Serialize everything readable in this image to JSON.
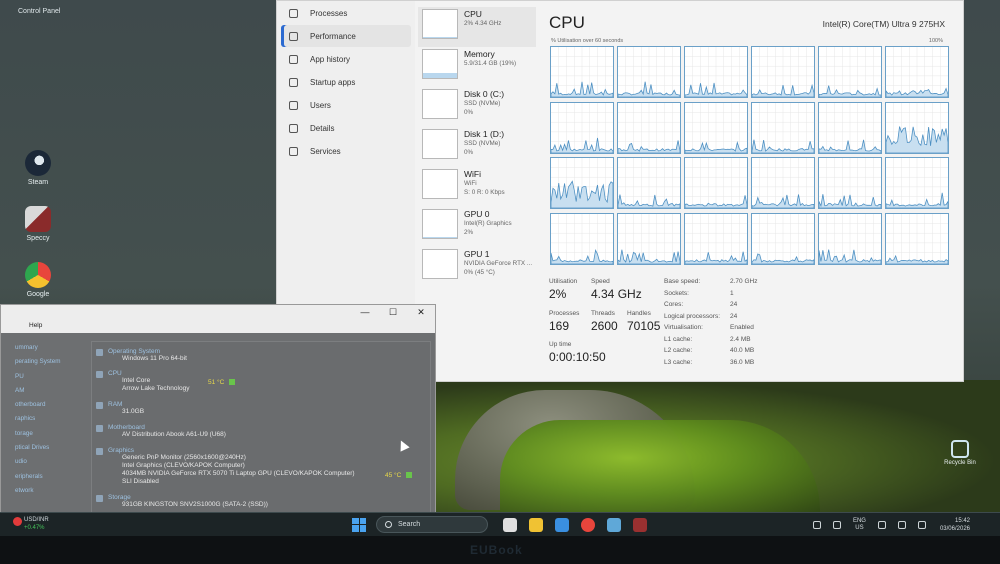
{
  "desktop": {
    "control_panel_label": "Control Panel",
    "icons": [
      {
        "name": "steam",
        "label": "Steam",
        "color": "#1b2838"
      },
      {
        "name": "speccy",
        "label": "Speccy",
        "color": "#8a2b2b"
      },
      {
        "name": "google",
        "label": "Google",
        "color": "#e8453c"
      }
    ],
    "recycle_bin_label": "Recycle Bin"
  },
  "task_manager": {
    "nav": [
      {
        "label": "Processes",
        "icon": "processes-icon"
      },
      {
        "label": "Performance",
        "icon": "performance-icon",
        "active": true
      },
      {
        "label": "App history",
        "icon": "app-history-icon"
      },
      {
        "label": "Startup apps",
        "icon": "startup-icon"
      },
      {
        "label": "Users",
        "icon": "users-icon"
      },
      {
        "label": "Details",
        "icon": "details-icon"
      },
      {
        "label": "Services",
        "icon": "services-icon"
      }
    ],
    "resources": [
      {
        "name": "CPU",
        "line1": "2% 4.34 GHz",
        "line2": "",
        "line3": "",
        "fill": 0.02
      },
      {
        "name": "Memory",
        "line1": "5.9/31.4 GB (19%)",
        "line2": "",
        "line3": "",
        "fill": 0.19
      },
      {
        "name": "Disk 0 (C:)",
        "line1": "SSD (NVMe)",
        "line2": "0%",
        "line3": "",
        "fill": 0
      },
      {
        "name": "Disk 1 (D:)",
        "line1": "SSD (NVMe)",
        "line2": "0%",
        "line3": "",
        "fill": 0
      },
      {
        "name": "WiFi",
        "line1": "WiFi",
        "line2": "S: 0 R: 0 Kbps",
        "line3": "",
        "fill": 0
      },
      {
        "name": "GPU 0",
        "line1": "Intel(R) Graphics",
        "line2": "2%",
        "line3": "",
        "fill": 0.02
      },
      {
        "name": "GPU 1",
        "line1": "NVIDIA GeForce RTX ...",
        "line2": "0% (45 °C)",
        "line3": "",
        "fill": 0
      }
    ],
    "main": {
      "title": "CPU",
      "model": "Intel(R) Core(TM) Ultra 9 275HX",
      "util_label": "% Utilisation over 60 seconds",
      "util_max": "100%",
      "core_count_display": 24,
      "stats": {
        "utilisation_label": "Utilisation",
        "utilisation": "2%",
        "speed_label": "Speed",
        "speed": "4.34 GHz",
        "processes_label": "Processes",
        "processes": "169",
        "threads_label": "Threads",
        "threads": "2600",
        "handles_label": "Handles",
        "handles": "70105",
        "uptime_label": "Up time",
        "uptime": "0:00:10:50"
      },
      "details": [
        {
          "k": "Base speed:",
          "v": "2.70 GHz"
        },
        {
          "k": "Sockets:",
          "v": "1"
        },
        {
          "k": "Cores:",
          "v": "24"
        },
        {
          "k": "Logical processors:",
          "v": "24"
        },
        {
          "k": "Virtualisation:",
          "v": "Enabled"
        },
        {
          "k": "L1 cache:",
          "v": "2.4 MB"
        },
        {
          "k": "L2 cache:",
          "v": "40.0 MB"
        },
        {
          "k": "L3 cache:",
          "v": "36.0 MB"
        }
      ]
    }
  },
  "speccy": {
    "menu_help": "Help",
    "controls": {
      "minimize": "—",
      "maximize": "☐",
      "close": "✕"
    },
    "sidebar": [
      "ummary",
      "perating System",
      "PU",
      "AM",
      "otherboard",
      "raphics",
      "torage",
      "ptical Drives",
      "udio",
      "eripherals",
      "etwork"
    ],
    "sections": {
      "os": {
        "title": "Operating System",
        "lines": [
          "Windows 11 Pro 64-bit"
        ]
      },
      "cpu": {
        "title": "CPU",
        "lines": [
          "Intel Core",
          "Arrow Lake Technology"
        ],
        "temp": "51 °C"
      },
      "ram": {
        "title": "RAM",
        "lines": [
          "31.0GB"
        ]
      },
      "motherboard": {
        "title": "Motherboard",
        "lines": [
          "AV Distribution Abook A61-U9 (U68)"
        ]
      },
      "graphics": {
        "title": "Graphics",
        "lines": [
          "Generic PnP Monitor (2560x1600@240Hz)",
          "Intel Graphics (CLEVO/KAPOK Computer)",
          "4034MB NVIDIA GeForce RTX 5070 Ti Laptop GPU (CLEVO/KAPOK Computer)",
          "SLI Disabled"
        ],
        "temp": "45 °C"
      },
      "storage": {
        "title": "Storage",
        "lines": [
          "931GB KINGSTON SNV2S1000G (SATA-2 (SSD))"
        ]
      }
    }
  },
  "taskbar": {
    "weather_badge": "3",
    "weather_title": "USD/INR",
    "weather_sub": "+0.47%",
    "search_placeholder": "Search",
    "apps": [
      {
        "name": "task-view",
        "color": "#e0e0e0"
      },
      {
        "name": "file-explorer",
        "color": "#f0c233"
      },
      {
        "name": "store",
        "color": "#3a8fe0"
      },
      {
        "name": "chrome",
        "color": "#e8453c"
      },
      {
        "name": "task-manager",
        "color": "#5fa8d8"
      },
      {
        "name": "speccy",
        "color": "#9a3030"
      }
    ],
    "lang_line1": "ENG",
    "lang_line2": "US",
    "time": "15:42",
    "date": "03/06/2026"
  },
  "bezel_logo": "EUBook",
  "colors": {
    "accent": "#2b6ad1",
    "graph_line": "#4c8fc2",
    "graph_fill": "#c8dff0"
  }
}
